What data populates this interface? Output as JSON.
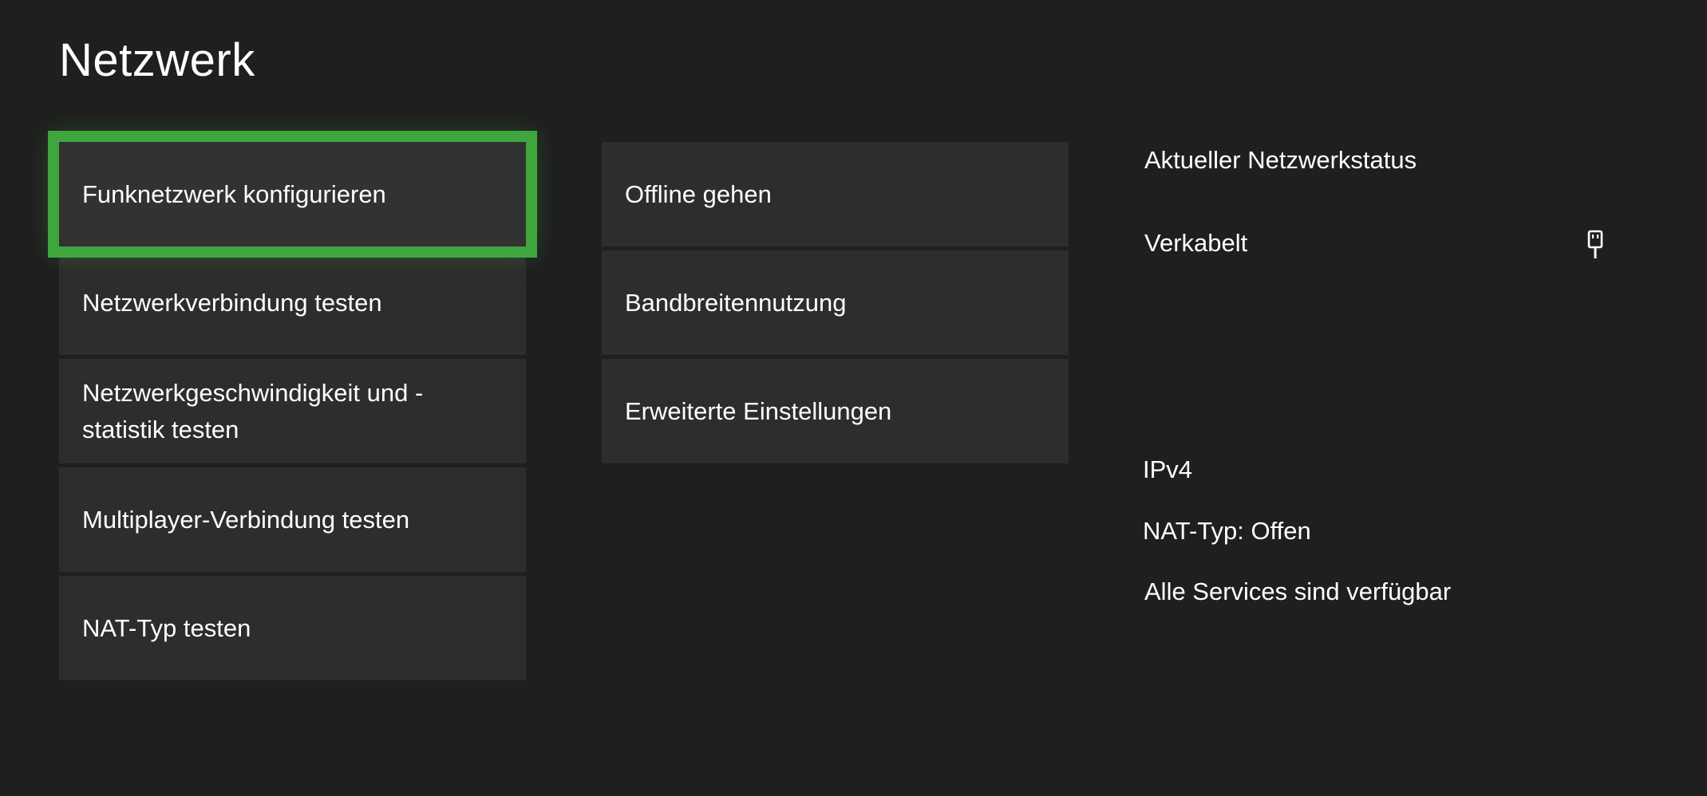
{
  "page": {
    "title": "Netzwerk"
  },
  "menu_left": {
    "items": [
      {
        "label": "Funknetzwerk konfigurieren",
        "focused": true
      },
      {
        "label": "Netzwerkverbindung testen"
      },
      {
        "label_line1": "Netzwerkgeschwindigkeit und -",
        "label_line2": "statistik testen"
      },
      {
        "label": "Multiplayer-Verbindung testen"
      },
      {
        "label": "NAT-Typ testen"
      }
    ]
  },
  "menu_mid": {
    "items": [
      {
        "label": "Offline gehen"
      },
      {
        "label": "Bandbreitennutzung"
      },
      {
        "label": "Erweiterte Einstellungen"
      }
    ]
  },
  "status": {
    "heading": "Aktueller Netzwerkstatus",
    "connection": "Verkabelt",
    "connection_icon": "ethernet-plug-icon",
    "ip_version": "IPv4",
    "nat_type": "NAT-Typ: Offen",
    "services": "Alle Services sind verfügbar"
  },
  "colors": {
    "background": "#1f1f1f",
    "tile": "#2d2d2d",
    "focus_accent": "#3fa63e",
    "text": "#ffffff"
  }
}
